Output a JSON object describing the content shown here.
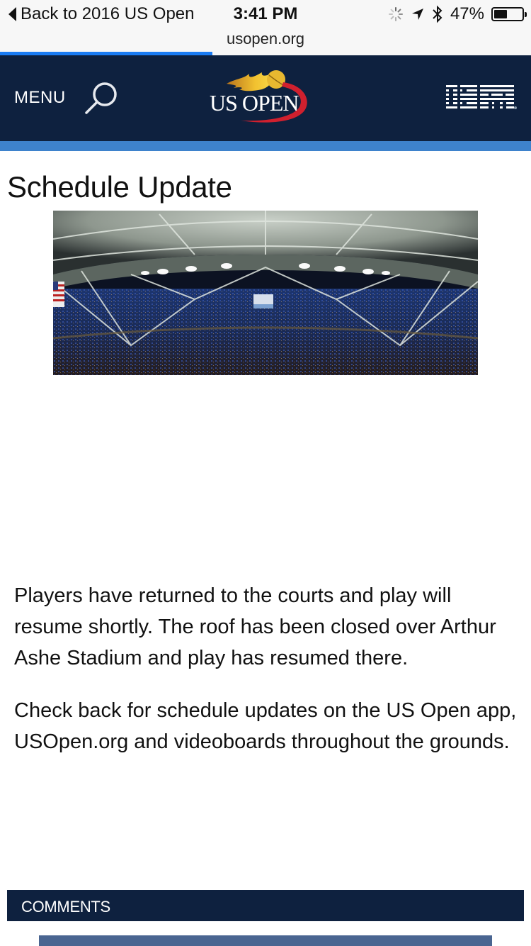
{
  "status_bar": {
    "back_label": "Back to 2016 US Open",
    "time": "3:41 PM",
    "icons": [
      "activity-spinner-icon",
      "location-arrow-icon",
      "bluetooth-icon"
    ],
    "battery_percent_label": "47%",
    "battery_level": 0.47
  },
  "browser": {
    "url": "usopen.org",
    "load_progress": 0.4,
    "progress_color": "#1a7cf4"
  },
  "header": {
    "menu_label": "MENU",
    "search_icon": "search-icon",
    "logo_text": "US OPEN",
    "sponsor": "IBM",
    "background_color": "#0e213f",
    "accent_color": "#3e82cc"
  },
  "article": {
    "title": "Schedule Update",
    "image_description": "Arthur Ashe Stadium interior with closed roof",
    "paragraphs": [
      "Players have returned to the courts and play will resume shortly. The roof has been closed over Arthur Ashe Stadium and play has resumed there.",
      "Check back for schedule updates on the US Open app, USOpen.org and videoboards throughout the grounds."
    ]
  },
  "comments": {
    "label": "COMMENTS"
  }
}
